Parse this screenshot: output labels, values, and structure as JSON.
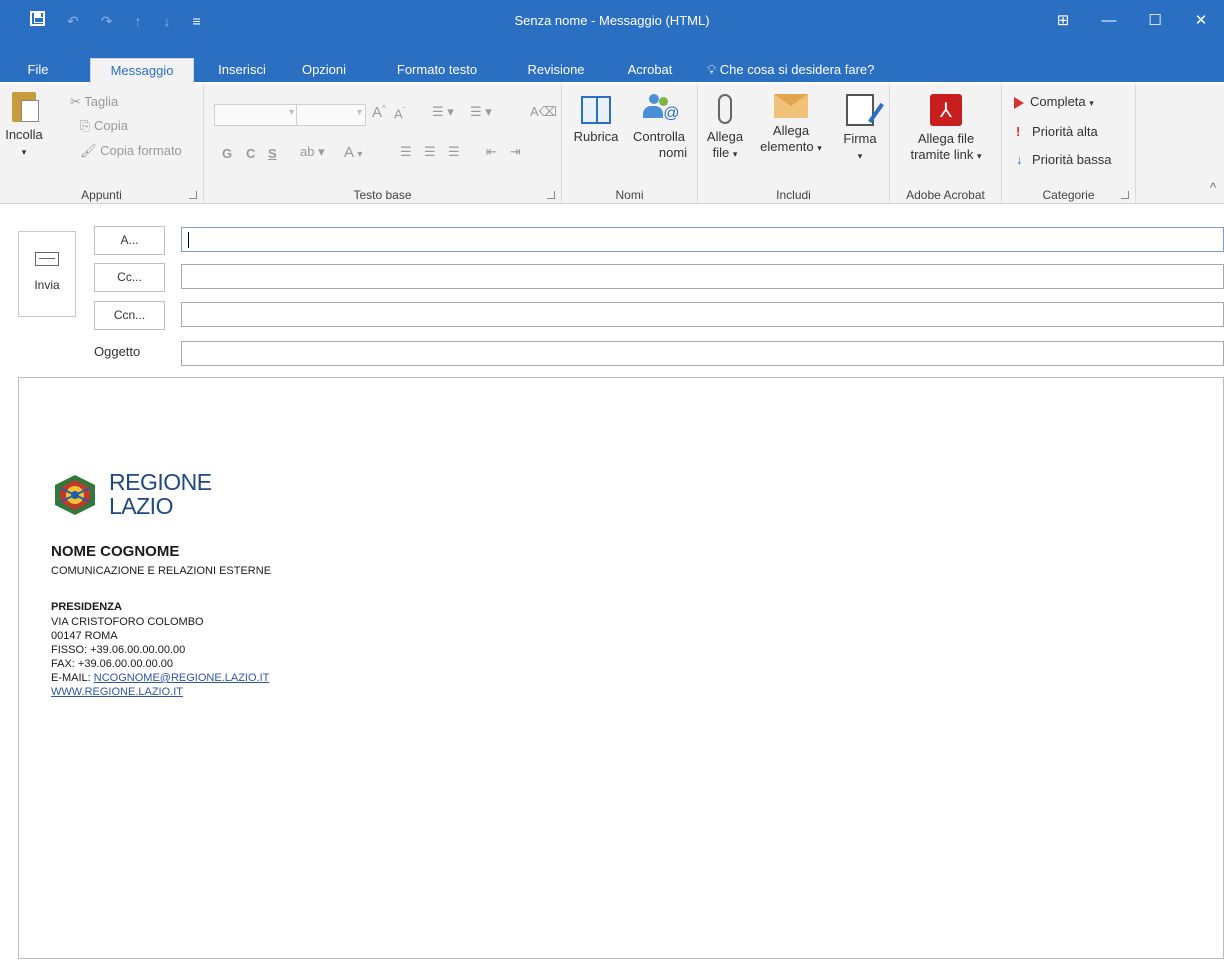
{
  "window": {
    "title": "Senza nome - Messaggio (HTML)",
    "controls": {
      "ribbon_options": "⊞",
      "minimize": "—",
      "maximize": "☐",
      "close": "✕"
    }
  },
  "qat": {
    "undo": "↶",
    "redo": "↷",
    "up": "↑",
    "down": "↓",
    "more": "≡"
  },
  "tabs": [
    {
      "label": "File"
    },
    {
      "label": "Messaggio"
    },
    {
      "label": "Inserisci"
    },
    {
      "label": "Opzioni"
    },
    {
      "label": "Formato testo"
    },
    {
      "label": "Revisione"
    },
    {
      "label": "Acrobat"
    }
  ],
  "tellme": {
    "label": "Che cosa si desidera fare?"
  },
  "ribbon": {
    "clipboard": {
      "paste": "Incolla",
      "cut": "Taglia",
      "copy": "Copia",
      "format_painter": "Copia formato",
      "label": "Appunti"
    },
    "basic_text": {
      "bold": "G",
      "italic": "C",
      "underline": "S",
      "grow_font": "A",
      "shrink_font": "A",
      "font_color": "A",
      "label": "Testo base"
    },
    "names": {
      "address_book": "Rubrica",
      "check_names_1": "Controlla",
      "check_names_2": "nomi",
      "label": "Nomi"
    },
    "include": {
      "attach_file_1": "Allega",
      "attach_file_2": "file",
      "attach_item_1": "Allega",
      "attach_item_2": "elemento",
      "signature": "Firma",
      "label": "Includi"
    },
    "acrobat": {
      "attach_link_1": "Allega file",
      "attach_link_2": "tramite link",
      "label": "Adobe Acrobat"
    },
    "tags": {
      "follow_up": "Completa",
      "high": "Priorità alta",
      "low": "Priorità bassa",
      "label": "Categorie"
    }
  },
  "compose": {
    "send": "Invia",
    "to": "A...",
    "cc": "Cc...",
    "bcc": "Ccn...",
    "subject_label": "Oggetto",
    "to_value": "",
    "cc_value": "",
    "bcc_value": "",
    "subject_value": ""
  },
  "signature": {
    "logo_line1": "REGIONE",
    "logo_line2": "LAZIO",
    "name": "NOME COGNOME",
    "department": "COMUNICAZIONE E RELAZIONI ESTERNE",
    "office": "PRESIDENZA",
    "street": "VIA CRISTOFORO COLOMBO",
    "city": "00147 ROMA",
    "phone": "FISSO: +39.06.00.00.00.00",
    "fax": "FAX: +39.06.00.00.00.00",
    "email_label": "E-MAIL: ",
    "email": "NCOGNOME@REGIONE.LAZIO.IT",
    "website": "WWW.REGIONE.LAZIO.IT"
  }
}
